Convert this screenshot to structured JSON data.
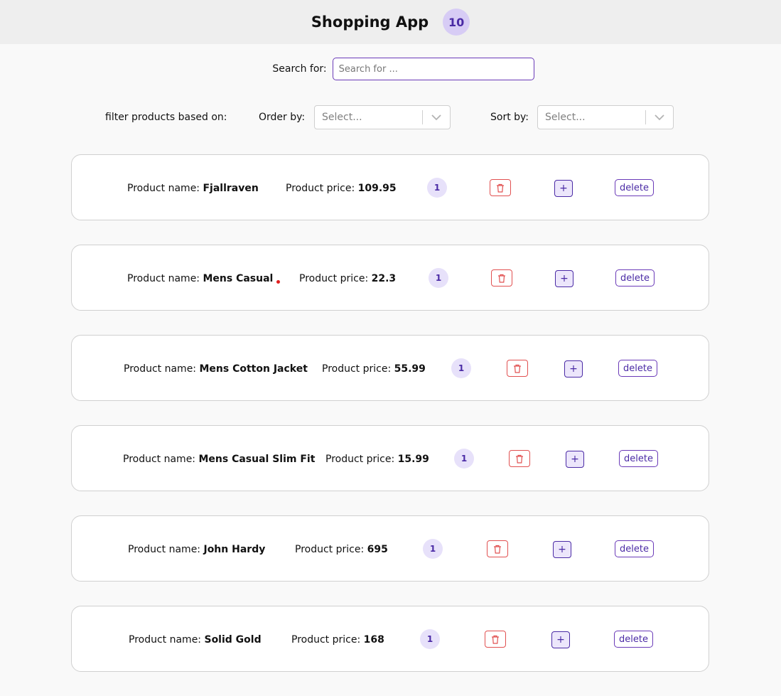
{
  "header": {
    "title": "Shopping App",
    "count": "10"
  },
  "search": {
    "label": "Search for:",
    "placeholder": "Search for ..."
  },
  "filters": {
    "label": "filter products based on:",
    "order_label": "Order by:",
    "order_value": "Select...",
    "sort_label": "Sort by:",
    "sort_value": "Select..."
  },
  "product_labels": {
    "name_prefix": "Product name:",
    "price_prefix": "Product price:",
    "delete": "delete",
    "plus": "+"
  },
  "products": [
    {
      "name": "Fjallraven",
      "price": "109.95",
      "qty": "1"
    },
    {
      "name": "Mens Casual",
      "price": "22.3",
      "qty": "1"
    },
    {
      "name": "Mens Cotton Jacket",
      "price": "55.99",
      "qty": "1"
    },
    {
      "name": "Mens Casual Slim Fit",
      "price": "15.99",
      "qty": "1"
    },
    {
      "name": "John Hardy",
      "price": "695",
      "qty": "1"
    },
    {
      "name": "Solid Gold",
      "price": "168",
      "qty": "1"
    }
  ],
  "colors": {
    "accent": "#4a2aa5",
    "badge_bg": "#d7ccf5",
    "danger": "#e15050"
  },
  "icons": {
    "trash": "trash-icon",
    "chevron": "chevron-down-icon"
  }
}
